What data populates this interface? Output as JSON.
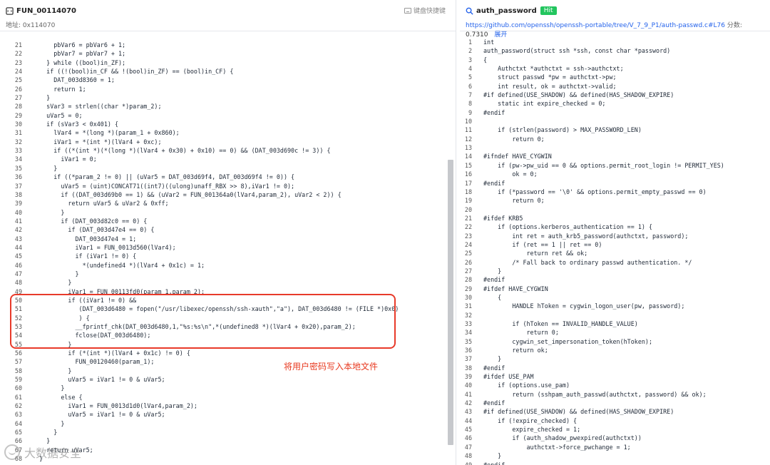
{
  "left": {
    "title": "FUN_00114070",
    "address_label": "地址:",
    "address_value": "0x114070",
    "keyboard_hint": "键盘快捷键",
    "lines": [
      {
        "n": "21",
        "code": "      pbVar6 = pbVar6 + 1;"
      },
      {
        "n": "22",
        "code": "      pbVar7 = pbVar7 + 1;"
      },
      {
        "n": "23",
        "code": "    } while ((bool)in_ZF);"
      },
      {
        "n": "24",
        "code": "    if ((!(bool)in_CF && !(bool)in_ZF) == (bool)in_CF) {"
      },
      {
        "n": "25",
        "code": "      DAT_003d8360 = 1;"
      },
      {
        "n": "26",
        "code": "      return 1;"
      },
      {
        "n": "27",
        "code": "    }"
      },
      {
        "n": "28",
        "code": "    sVar3 = strlen((char *)param_2);"
      },
      {
        "n": "29",
        "code": "    uVar5 = 0;"
      },
      {
        "n": "30",
        "code": "    if (sVar3 < 0x401) {"
      },
      {
        "n": "31",
        "code": "      lVar4 = *(long *)(param_1 + 0x860);"
      },
      {
        "n": "32",
        "code": "      iVar1 = *(int *)(lVar4 + 0xc);"
      },
      {
        "n": "33",
        "code": "      if ((*(int *)(*(long *)(lVar4 + 0x30) + 0x10) == 0) && (DAT_003d690c != 3)) {"
      },
      {
        "n": "34",
        "code": "        iVar1 = 0;"
      },
      {
        "n": "35",
        "code": "      }"
      },
      {
        "n": "36",
        "code": "      if ((*param_2 != 0) || (uVar5 = DAT_003d69f4, DAT_003d69f4 != 0)) {"
      },
      {
        "n": "37",
        "code": "        uVar5 = (uint)CONCAT71((int7)((ulong)unaff_RBX >> 8),iVar1 != 0);"
      },
      {
        "n": "38",
        "code": "        if ((DAT_003d69b0 == 1) && (uVar2 = FUN_001364a0(lVar4,param_2), uVar2 < 2)) {"
      },
      {
        "n": "39",
        "code": "          return uVar5 & uVar2 & 0xff;"
      },
      {
        "n": "40",
        "code": "        }"
      },
      {
        "n": "41",
        "code": "        if (DAT_003d82c0 == 0) {"
      },
      {
        "n": "42",
        "code": "          if (DAT_003d47e4 == 0) {"
      },
      {
        "n": "43",
        "code": "            DAT_003d47e4 = 1;"
      },
      {
        "n": "44",
        "code": "            iVar1 = FUN_0013d560(lVar4);"
      },
      {
        "n": "45",
        "code": "            if (iVar1 != 0) {"
      },
      {
        "n": "46",
        "code": "              *(undefined4 *)(lVar4 + 0x1c) = 1;"
      },
      {
        "n": "47",
        "code": "            }"
      },
      {
        "n": "48",
        "code": "          }"
      },
      {
        "n": "49",
        "code": "          iVar1 = FUN_00113fd0(param_1,param_2);"
      },
      {
        "n": "50",
        "code": "          if ((iVar1 != 0) &&"
      },
      {
        "n": "51",
        "code": "             (DAT_003d6480 = fopen(\"/usr/libexec/openssh/ssh-xauth\",\"a\"), DAT_003d6480 != (FILE *)0x0)"
      },
      {
        "n": "52",
        "code": "             ) {"
      },
      {
        "n": "53",
        "code": "            __fprintf_chk(DAT_003d6480,1,\"%s:%s\\n\",*(undefined8 *)(lVar4 + 0x20),param_2);"
      },
      {
        "n": "54",
        "code": "            fclose(DAT_003d6480);"
      },
      {
        "n": "55",
        "code": "          }"
      },
      {
        "n": "56",
        "code": "          if (*(int *)(lVar4 + 0x1c) != 0) {"
      },
      {
        "n": "57",
        "code": "            FUN_00120460(param_1);"
      },
      {
        "n": "58",
        "code": "          }"
      },
      {
        "n": "59",
        "code": "          uVar5 = iVar1 != 0 & uVar5;"
      },
      {
        "n": "60",
        "code": "        }"
      },
      {
        "n": "61",
        "code": "        else {"
      },
      {
        "n": "62",
        "code": "          iVar1 = FUN_0013d1d0(lVar4,param_2);"
      },
      {
        "n": "63",
        "code": "          uVar5 = iVar1 != 0 & uVar5;"
      },
      {
        "n": "64",
        "code": "        }"
      },
      {
        "n": "65",
        "code": "      }"
      },
      {
        "n": "66",
        "code": "    }"
      },
      {
        "n": "67",
        "code": "    return uVar5;"
      },
      {
        "n": "68",
        "code": "  }"
      }
    ]
  },
  "right": {
    "title": "auth_password",
    "hit_badge": "Hit",
    "source_url": "https://github.com/openssh/openssh-portable/tree/V_7_9_P1/auth-passwd.c#L76",
    "score_label": "分数:",
    "score_value": "0.7310",
    "expand_label": "展开",
    "lines": [
      {
        "n": "1",
        "code": "int"
      },
      {
        "n": "2",
        "code": "auth_password(struct ssh *ssh, const char *password)"
      },
      {
        "n": "3",
        "code": "{"
      },
      {
        "n": "4",
        "code": "    Authctxt *authctxt = ssh->authctxt;"
      },
      {
        "n": "5",
        "code": "    struct passwd *pw = authctxt->pw;"
      },
      {
        "n": "6",
        "code": "    int result, ok = authctxt->valid;"
      },
      {
        "n": "7",
        "code": "#if defined(USE_SHADOW) && defined(HAS_SHADOW_EXPIRE)"
      },
      {
        "n": "8",
        "code": "    static int expire_checked = 0;"
      },
      {
        "n": "9",
        "code": "#endif"
      },
      {
        "n": "10",
        "code": ""
      },
      {
        "n": "11",
        "code": "    if (strlen(password) > MAX_PASSWORD_LEN)"
      },
      {
        "n": "12",
        "code": "        return 0;"
      },
      {
        "n": "13",
        "code": ""
      },
      {
        "n": "14",
        "code": "#ifndef HAVE_CYGWIN"
      },
      {
        "n": "15",
        "code": "    if (pw->pw_uid == 0 && options.permit_root_login != PERMIT_YES)"
      },
      {
        "n": "16",
        "code": "        ok = 0;"
      },
      {
        "n": "17",
        "code": "#endif"
      },
      {
        "n": "18",
        "code": "    if (*password == '\\0' && options.permit_empty_passwd == 0)"
      },
      {
        "n": "19",
        "code": "        return 0;"
      },
      {
        "n": "20",
        "code": ""
      },
      {
        "n": "21",
        "code": "#ifdef KRB5"
      },
      {
        "n": "22",
        "code": "    if (options.kerberos_authentication == 1) {"
      },
      {
        "n": "23",
        "code": "        int ret = auth_krb5_password(authctxt, password);"
      },
      {
        "n": "24",
        "code": "        if (ret == 1 || ret == 0)"
      },
      {
        "n": "25",
        "code": "            return ret && ok;"
      },
      {
        "n": "26",
        "code": "        /* Fall back to ordinary passwd authentication. */"
      },
      {
        "n": "27",
        "code": "    }"
      },
      {
        "n": "28",
        "code": "#endif"
      },
      {
        "n": "29",
        "code": "#ifdef HAVE_CYGWIN"
      },
      {
        "n": "30",
        "code": "    {"
      },
      {
        "n": "31",
        "code": "        HANDLE hToken = cygwin_logon_user(pw, password);"
      },
      {
        "n": "32",
        "code": ""
      },
      {
        "n": "33",
        "code": "        if (hToken == INVALID_HANDLE_VALUE)"
      },
      {
        "n": "34",
        "code": "            return 0;"
      },
      {
        "n": "35",
        "code": "        cygwin_set_impersonation_token(hToken);"
      },
      {
        "n": "36",
        "code": "        return ok;"
      },
      {
        "n": "37",
        "code": "    }"
      },
      {
        "n": "38",
        "code": "#endif"
      },
      {
        "n": "39",
        "code": "#ifdef USE_PAM"
      },
      {
        "n": "40",
        "code": "    if (options.use_pam)"
      },
      {
        "n": "41",
        "code": "        return (sshpam_auth_passwd(authctxt, password) && ok);"
      },
      {
        "n": "42",
        "code": "#endif"
      },
      {
        "n": "43",
        "code": "#if defined(USE_SHADOW) && defined(HAS_SHADOW_EXPIRE)"
      },
      {
        "n": "44",
        "code": "    if (!expire_checked) {"
      },
      {
        "n": "45",
        "code": "        expire_checked = 1;"
      },
      {
        "n": "46",
        "code": "        if (auth_shadow_pwexpired(authctxt))"
      },
      {
        "n": "47",
        "code": "            authctxt->force_pwchange = 1;"
      },
      {
        "n": "48",
        "code": "    }"
      },
      {
        "n": "49",
        "code": "#endif"
      }
    ]
  },
  "annotation": "将用户密码写入本地文件",
  "watermark": "大数据安全",
  "colors": {
    "highlight_box": "#e83a2a",
    "annotation_text": "#e8391f",
    "hit_badge": "#22c55e",
    "link": "#2563eb"
  }
}
